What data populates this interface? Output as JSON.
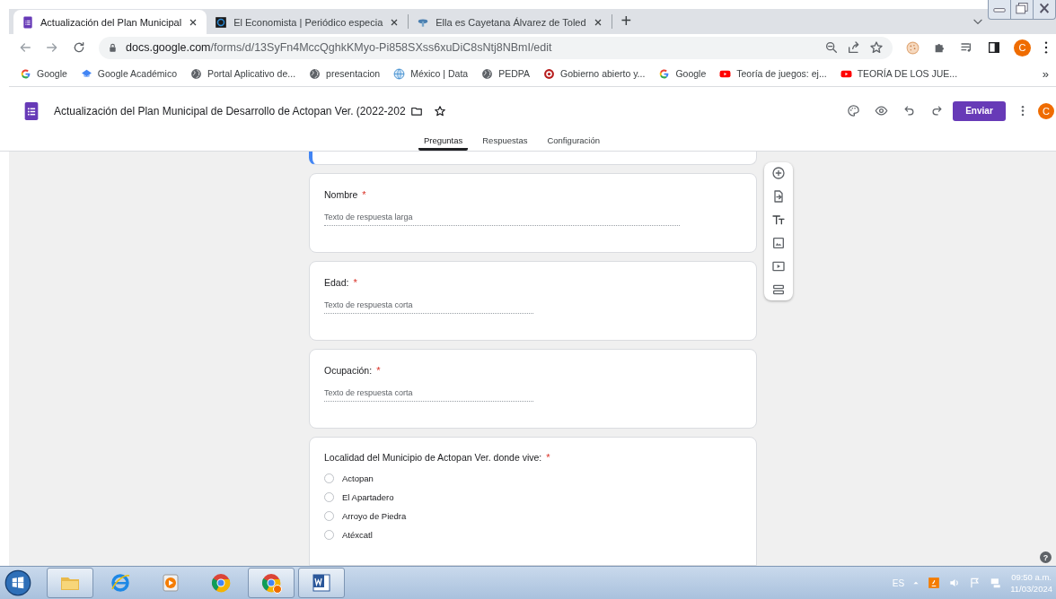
{
  "browser": {
    "tabs": [
      {
        "kind": "forms",
        "title": "Actualización del Plan Municipal",
        "selected": true
      },
      {
        "kind": "news",
        "title": "El Economista | Periódico especia",
        "selected": false
      },
      {
        "kind": "site",
        "title": "Ella es Cayetana Álvarez de Toled",
        "selected": false
      }
    ],
    "new_tab": "+",
    "url_host": "docs.google.com",
    "url_path": "/forms/d/13SyFn4MccQghkKMyo-Pi858SXss6xuDiC8sNtj8NBmI/edit",
    "profile_initial": "C",
    "bookmarks": [
      {
        "kind": "google",
        "label": "Google"
      },
      {
        "kind": "scholar",
        "label": "Google Académico"
      },
      {
        "kind": "globe",
        "label": "Portal Aplicativo de..."
      },
      {
        "kind": "globe",
        "label": "presentacion"
      },
      {
        "kind": "world",
        "label": "México | Data"
      },
      {
        "kind": "globe",
        "label": "PEDPA"
      },
      {
        "kind": "target",
        "label": "Gobierno abierto y..."
      },
      {
        "kind": "google",
        "label": "Google"
      },
      {
        "kind": "video",
        "label": "Teoría de juegos: ej..."
      },
      {
        "kind": "video",
        "label": "TEORÍA DE LOS JUE..."
      }
    ],
    "more_bookmarks": "»"
  },
  "form_header": {
    "title": "Actualización del Plan Municipal de Desarrollo de Actopan Ver. (2022-202",
    "send_button": "Enviar",
    "profile_initial": "C"
  },
  "tabs": [
    {
      "label": "Preguntas",
      "selected": true
    },
    {
      "label": "Respuestas",
      "selected": false
    },
    {
      "label": "Configuración",
      "selected": false
    }
  ],
  "questions": [
    {
      "kind": "paragraph",
      "title": "Nombre",
      "required_mark": "*",
      "placeholder": "Texto de respuesta larga"
    },
    {
      "kind": "short",
      "title": "Edad:",
      "required_mark": "*",
      "placeholder": "Texto de respuesta corta"
    },
    {
      "kind": "short",
      "title": "Ocupación:",
      "required_mark": "*",
      "placeholder": "Texto de respuesta corta"
    },
    {
      "kind": "choice",
      "title": "Localidad del Municipio de Actopan Ver. donde vive:",
      "required_mark": "*",
      "options": [
        {
          "label": "Actopan",
          "selected": false
        },
        {
          "label": "El Apartadero",
          "selected": false
        },
        {
          "label": "Arroyo de Piedra",
          "selected": false
        },
        {
          "label": "Atéxcatl",
          "selected": false
        }
      ]
    }
  ],
  "help": "?",
  "taskbar": {
    "apps": [
      {
        "kind": "folder",
        "running": true
      },
      {
        "kind": "ie",
        "running": false
      },
      {
        "kind": "media",
        "running": false
      },
      {
        "kind": "chrome",
        "running": false
      },
      {
        "kind": "chrome-profile",
        "running": true
      },
      {
        "kind": "word",
        "running": true
      }
    ],
    "language": "ES",
    "time": "09:50 a.m.",
    "date": "11/03/2024"
  }
}
